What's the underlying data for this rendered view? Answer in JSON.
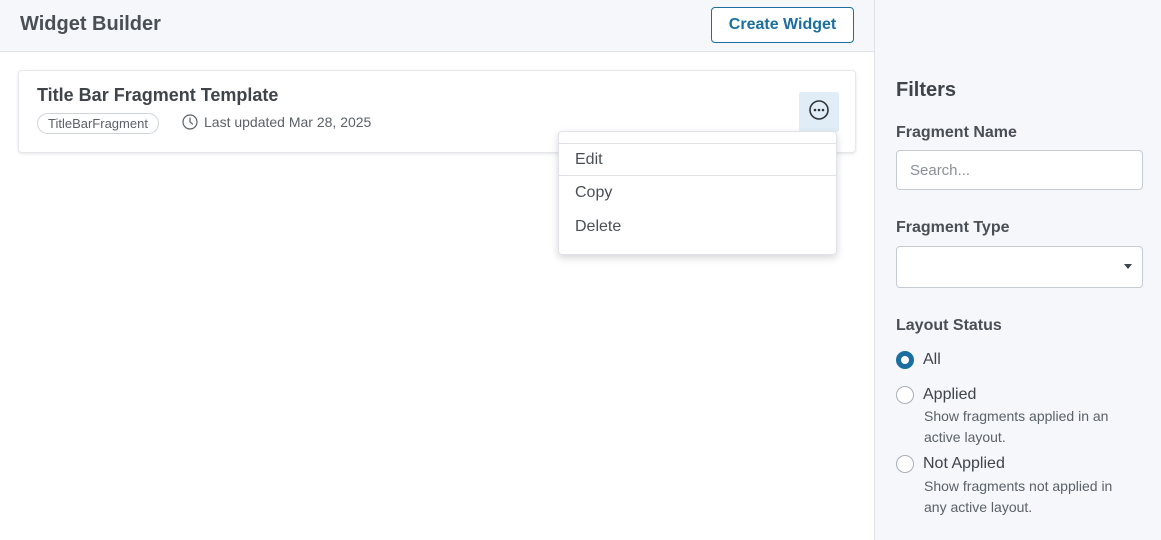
{
  "header": {
    "title": "Widget Builder",
    "create_label": "Create Widget"
  },
  "card": {
    "title": "Title Bar Fragment Template",
    "tag": "TitleBarFragment",
    "updated": "Last updated Mar 28, 2025",
    "more_icon": "ellipsis-circle-icon"
  },
  "menu": {
    "items": [
      {
        "label": "Edit"
      },
      {
        "label": "Copy"
      },
      {
        "label": "Delete"
      }
    ]
  },
  "filters": {
    "title": "Filters",
    "name_label": "Fragment Name",
    "name_placeholder": "Search...",
    "name_value": "",
    "type_label": "Fragment Type",
    "type_value": "",
    "status_label": "Layout Status",
    "status_options": [
      {
        "label": "All",
        "checked": true
      },
      {
        "label": "Applied",
        "help": "Show fragments applied in an active layout.",
        "checked": false
      },
      {
        "label": "Not Applied",
        "help": "Show fragments not applied in any active layout.",
        "checked": false
      }
    ]
  },
  "colors": {
    "accent": "#1a6fa0",
    "sidebar_bg": "#f5f7fa",
    "more_button_bg": "#e1edf6"
  }
}
